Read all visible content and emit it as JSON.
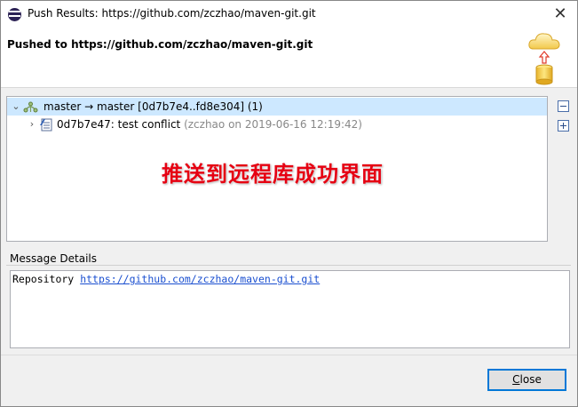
{
  "window": {
    "title": "Push Results: https://github.com/zczhao/maven-git.git",
    "close_glyph": "✕"
  },
  "banner": {
    "title": "Pushed to https://github.com/zczhao/maven-git.git",
    "graphic": "cloud-upload-repository-icon"
  },
  "tree": {
    "rows": [
      {
        "label": "master → master [0d7b7e4..fd8e304] (1)",
        "expanded": true,
        "selected": true,
        "icon": "repository-branch-icon"
      },
      {
        "label": "0d7b7e47: test conflict",
        "meta": "(zczhao on 2019-06-16 12:19:42)",
        "expanded": false,
        "icon": "commit-icon"
      }
    ],
    "overlay_caption": "推送到远程库成功界面"
  },
  "side_buttons": {
    "collapse_icon": "collapse-all-icon",
    "expand_icon": "expand-all-icon"
  },
  "message": {
    "section_label": "Message Details",
    "prefix": "Repository",
    "link": "https://github.com/zczhao/maven-git.git"
  },
  "footer": {
    "close_label_first": "C",
    "close_label_rest": "lose"
  },
  "colors": {
    "selection": "#cde8ff",
    "overlay_text": "#e60012",
    "link": "#1a4fd0",
    "button_border": "#0078d7"
  }
}
